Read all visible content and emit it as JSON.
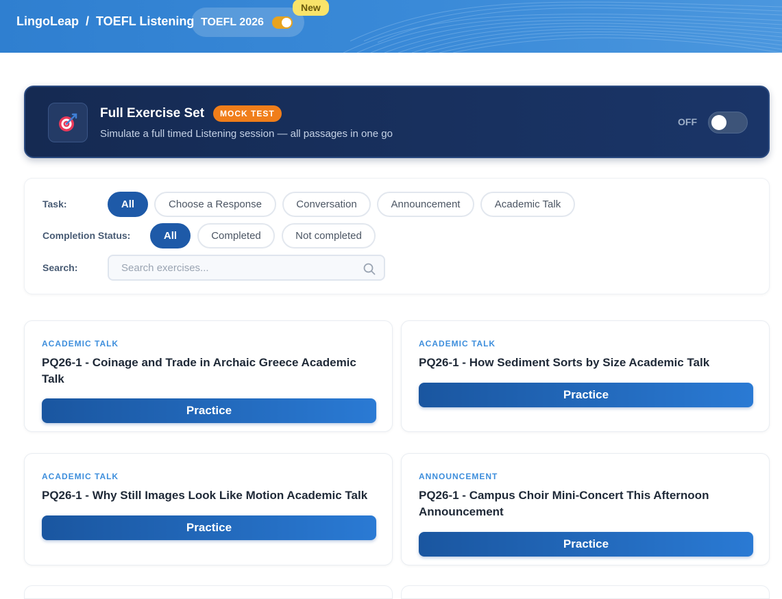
{
  "header": {
    "brand": "LingoLeap",
    "separator": "/",
    "section": "TOEFL Listening",
    "version_label": "TOEFL 2026",
    "new_badge": "New"
  },
  "mock": {
    "title": "Full Exercise Set",
    "badge": "MOCK TEST",
    "subtitle": "Simulate a full timed Listening session — all passages in one go",
    "toggle_state": "OFF",
    "icon": "target-icon"
  },
  "filters": {
    "task_label": "Task:",
    "task_chips": [
      "All",
      "Choose a Response",
      "Conversation",
      "Announcement",
      "Academic Talk"
    ],
    "task_active": "All",
    "status_label": "Completion Status:",
    "status_chips": [
      "All",
      "Completed",
      "Not completed"
    ],
    "status_active": "All",
    "search_label": "Search:",
    "search_placeholder": "Search exercises..."
  },
  "cards": [
    {
      "tag": "ACADEMIC TALK",
      "title": "PQ26-1 - Coinage and Trade in Archaic Greece Academic Talk",
      "button": "Practice"
    },
    {
      "tag": "ACADEMIC TALK",
      "title": "PQ26-1 - How Sediment Sorts by Size Academic Talk",
      "button": "Practice"
    },
    {
      "tag": "ACADEMIC TALK",
      "title": "PQ26-1 - Why Still Images Look Like Motion Academic Talk",
      "button": "Practice"
    },
    {
      "tag": "ANNOUNCEMENT",
      "title": "PQ26-1 - Campus Choir Mini-Concert This Afternoon Announcement",
      "button": "Practice"
    }
  ],
  "colors": {
    "header": "#3a8ad8",
    "mock_bg": "#152a52",
    "accent": "#1e5aa8",
    "badge_orange": "#f07e1a",
    "tag_blue": "#3d8edc"
  }
}
